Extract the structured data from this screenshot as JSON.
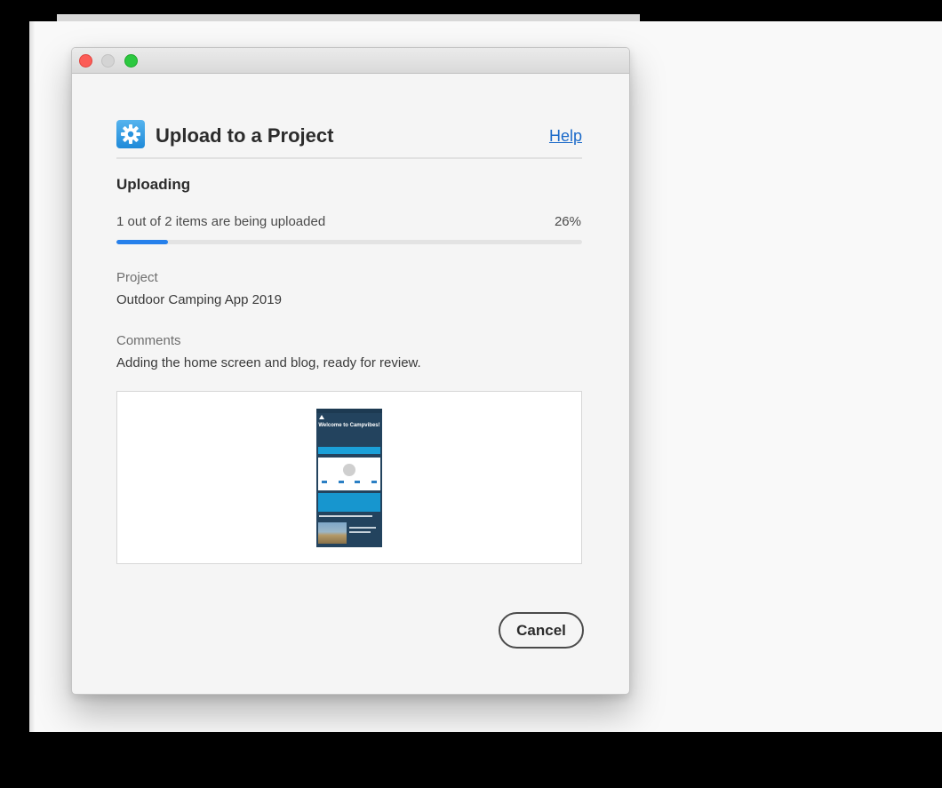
{
  "dialog": {
    "title": "Upload to a Project",
    "help_label": "Help",
    "app_icon": "gear-icon",
    "accent_color": "#2680eb"
  },
  "upload": {
    "heading": "Uploading",
    "status": "1 out of 2 items are being uploaded",
    "percent_label": "26%",
    "progress_percent": 26
  },
  "project": {
    "label": "Project",
    "value": "Outdoor Camping App 2019"
  },
  "comments": {
    "label": "Comments",
    "value": "Adding the home screen and blog, ready for review."
  },
  "preview": {
    "welcome_text": "Welcome to Campvibes!"
  },
  "actions": {
    "cancel_label": "Cancel"
  }
}
